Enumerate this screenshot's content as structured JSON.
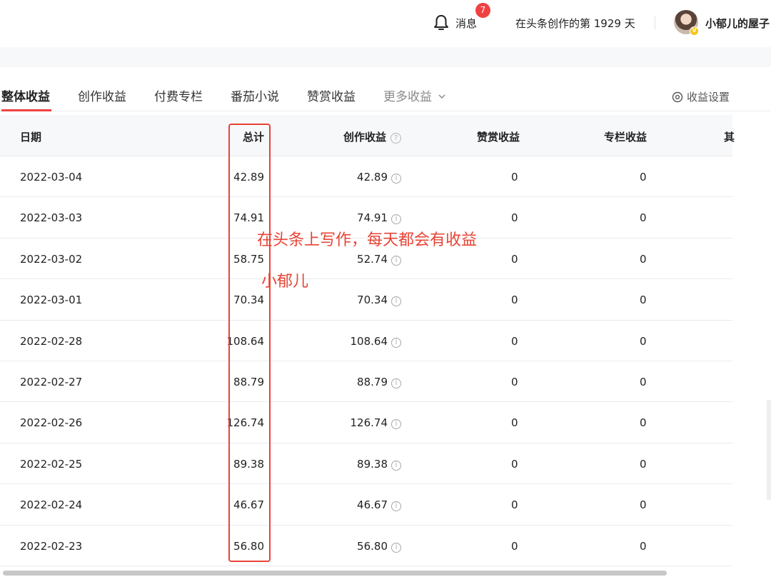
{
  "header": {
    "messages_label": "消息",
    "messages_badge": "7",
    "creation_days_text": "在头条创作的第 1929 天",
    "username": "小郁儿的屋子",
    "bell_icon": "bell-icon"
  },
  "tabs": {
    "items": [
      "整体收益",
      "创作收益",
      "付费专栏",
      "番茄小说",
      "赞赏收益"
    ],
    "active_index": 0,
    "more_label": "更多收益",
    "settings_label": "收益设置"
  },
  "table": {
    "columns": {
      "date": "日期",
      "total": "总计",
      "creation": "创作收益",
      "reward": "赞赏收益",
      "column_income": "专栏收益",
      "other_partial": "其"
    },
    "rows": [
      {
        "date": "2022-03-04",
        "total": "42.89",
        "creation": "42.89",
        "reward": "0",
        "column_income": "0"
      },
      {
        "date": "2022-03-03",
        "total": "74.91",
        "creation": "74.91",
        "reward": "0",
        "column_income": "0"
      },
      {
        "date": "2022-03-02",
        "total": "58.75",
        "creation": "52.74",
        "reward": "0",
        "column_income": "0"
      },
      {
        "date": "2022-03-01",
        "total": "70.34",
        "creation": "70.34",
        "reward": "0",
        "column_income": "0"
      },
      {
        "date": "2022-02-28",
        "total": "108.64",
        "creation": "108.64",
        "reward": "0",
        "column_income": "0"
      },
      {
        "date": "2022-02-27",
        "total": "88.79",
        "creation": "88.79",
        "reward": "0",
        "column_income": "0"
      },
      {
        "date": "2022-02-26",
        "total": "126.74",
        "creation": "126.74",
        "reward": "0",
        "column_income": "0"
      },
      {
        "date": "2022-02-25",
        "total": "89.38",
        "creation": "89.38",
        "reward": "0",
        "column_income": "0"
      },
      {
        "date": "2022-02-24",
        "total": "46.67",
        "creation": "46.67",
        "reward": "0",
        "column_income": "0"
      },
      {
        "date": "2022-02-23",
        "total": "56.80",
        "creation": "56.80",
        "reward": "0",
        "column_income": "0"
      }
    ]
  },
  "annotation": {
    "line1": "在头条上写作，每天都会有收益",
    "line2": "小郁儿",
    "color": "#e84335"
  },
  "colors": {
    "accent_red": "#f04142",
    "header_bg": "#f7f8fa"
  }
}
